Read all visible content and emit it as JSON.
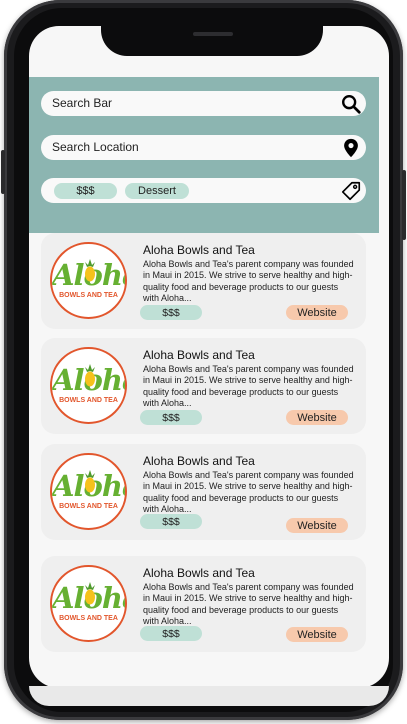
{
  "search": {
    "bar_placeholder": "Search Bar",
    "location_placeholder": "Search Location"
  },
  "filters": {
    "chips": [
      "$$$",
      "Dessert"
    ]
  },
  "results": [
    {
      "logo_script": "Aloha",
      "logo_subtitle": "BOWLS AND TEA",
      "title": "Aloha Bowls and Tea",
      "description": "Aloha Bowls and Tea's parent company was founded in Maui in 2015. We strive to serve healthy and high-quality food and beverage products to our guests with Aloha...",
      "price": "$$$",
      "website_label": "Website"
    },
    {
      "logo_script": "Aloha",
      "logo_subtitle": "BOWLS AND TEA",
      "title": "Aloha Bowls and Tea",
      "description": "Aloha Bowls and Tea's parent company was founded in Maui in 2015. We strive to serve healthy and high-quality food and beverage products to our guests with Aloha...",
      "price": "$$$",
      "website_label": "Website"
    },
    {
      "logo_script": "Aloha",
      "logo_subtitle": "BOWLS AND TEA",
      "title": "Aloha Bowls and Tea",
      "description": "Aloha Bowls and Tea's parent company was founded in Maui in 2015. We strive to serve healthy and high-quality food and beverage products to our guests with Aloha...",
      "price": "$$$",
      "website_label": "Website"
    },
    {
      "logo_script": "Aloha",
      "logo_subtitle": "BOWLS AND TEA",
      "title": "Aloha Bowls and Tea",
      "description": "Aloha Bowls and Tea's parent company was founded in Maui in 2015. We strive to serve healthy and high-quality food and beverage products to our guests with Aloha...",
      "price": "$$$",
      "website_label": "Website"
    }
  ],
  "icons": {
    "search": "search-icon",
    "location": "location-pin-icon",
    "tag": "tag-icon"
  },
  "colors": {
    "header": "#8cb5b1",
    "chip": "#bfe0d6",
    "website": "#f7c9ac",
    "logo_green": "#66b032",
    "logo_orange": "#e2562c"
  }
}
